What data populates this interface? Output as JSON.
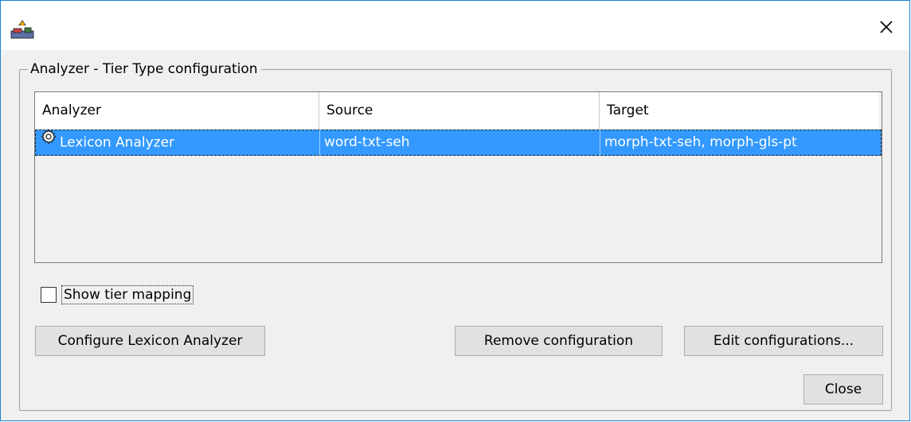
{
  "window": {
    "close_icon": "close-icon"
  },
  "group": {
    "title": "Analyzer - Tier Type configuration"
  },
  "table": {
    "headers": [
      "Analyzer",
      "Source",
      "Target"
    ],
    "rows": [
      {
        "analyzer": "Lexicon Analyzer",
        "icon": "gear-icon",
        "source": "word-txt-seh",
        "target": "morph-txt-seh, morph-gls-pt",
        "selected": true
      }
    ]
  },
  "checkbox": {
    "label": "Show tier mapping",
    "checked": false
  },
  "buttons": {
    "configure": "Configure Lexicon Analyzer",
    "remove": "Remove configuration",
    "edit": "Edit configurations...",
    "close": "Close"
  },
  "colors": {
    "selection": "#3399ff",
    "window_border": "#1883d7",
    "background": "#f0f0f0"
  }
}
